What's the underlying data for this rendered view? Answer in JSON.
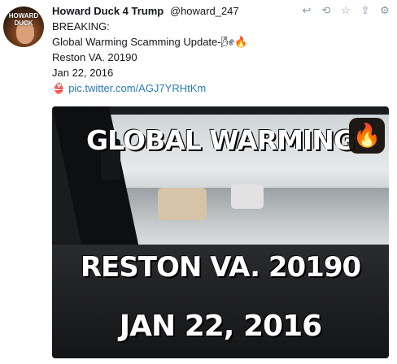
{
  "tweet": {
    "avatar_text": "HOWARD DUCK",
    "display_name": "Howard Duck 4 Trump",
    "handle": "@howard_247",
    "lines": [
      "BREAKING:",
      "Global Warming Scamming Update-🌬🔥",
      "Reston VA. 20190",
      "Jan 22, 2016"
    ],
    "link": "pic.twitter.com/AGJ7YRHtKm"
  },
  "actions": [
    "reply-icon",
    "retweet-icon",
    "like-icon",
    "share-icon",
    "settings-icon"
  ],
  "media": {
    "caption_top": "GLOBAL WARMING",
    "caption_mid": "RESTON VA. 20190",
    "caption_bottom": "JAN 22, 2016"
  }
}
